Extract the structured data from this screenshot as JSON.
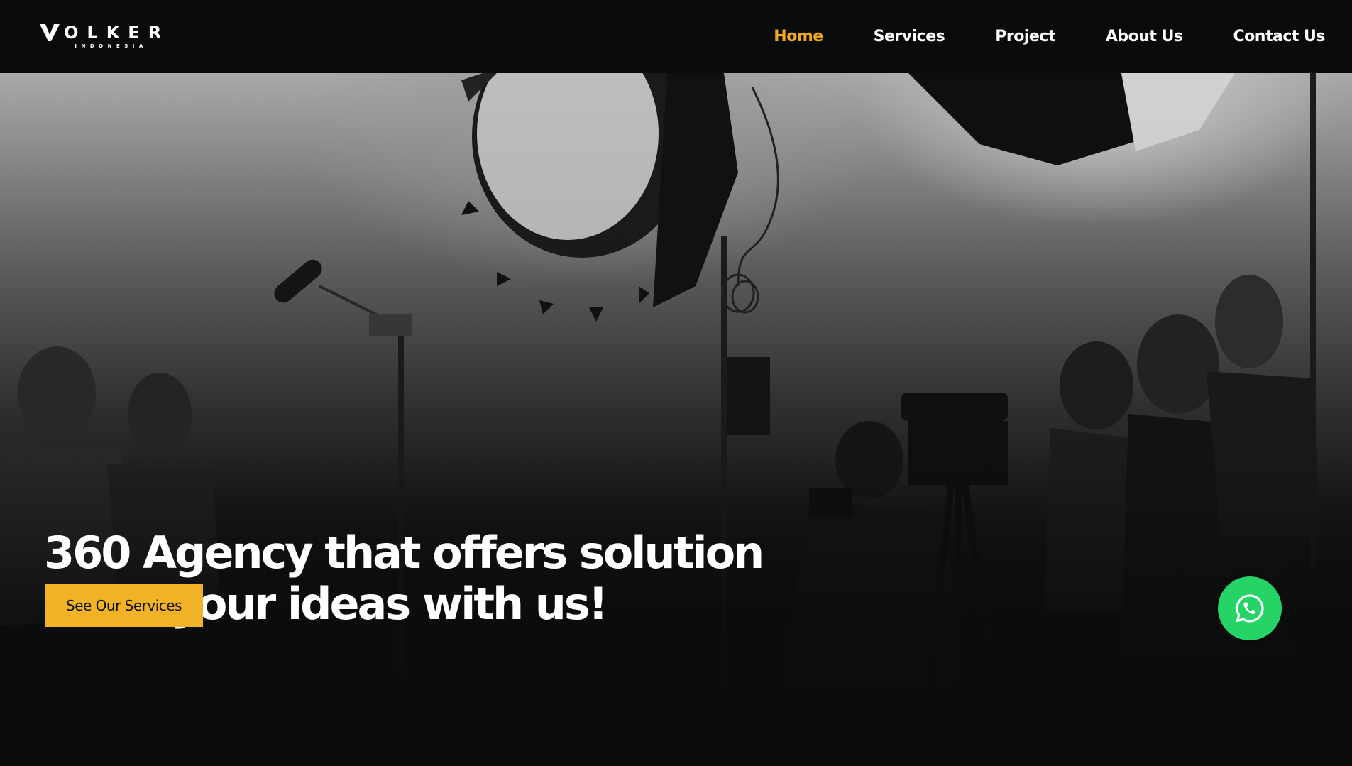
{
  "brand": {
    "logo_text": "OLKER",
    "logo_initial": "V",
    "logo_subtitle": "INDONESIA"
  },
  "nav": {
    "items": [
      {
        "label": "Home",
        "active": true
      },
      {
        "label": "Services",
        "active": false
      },
      {
        "label": "Project",
        "active": false
      },
      {
        "label": "About Us",
        "active": false
      },
      {
        "label": "Contact Us",
        "active": false
      }
    ]
  },
  "hero": {
    "headline_line1": "360 Agency that offers solution",
    "headline_line2": "Cook your ideas with us!",
    "cta_label": "See Our Services",
    "background_description_icon": "film-studio-photo"
  },
  "floating": {
    "whatsapp_icon": "whatsapp-icon"
  },
  "colors": {
    "accent": "#f2b227",
    "nav_active": "#f0a91f",
    "whatsapp": "#25d366",
    "background": "#0b0d0d"
  }
}
